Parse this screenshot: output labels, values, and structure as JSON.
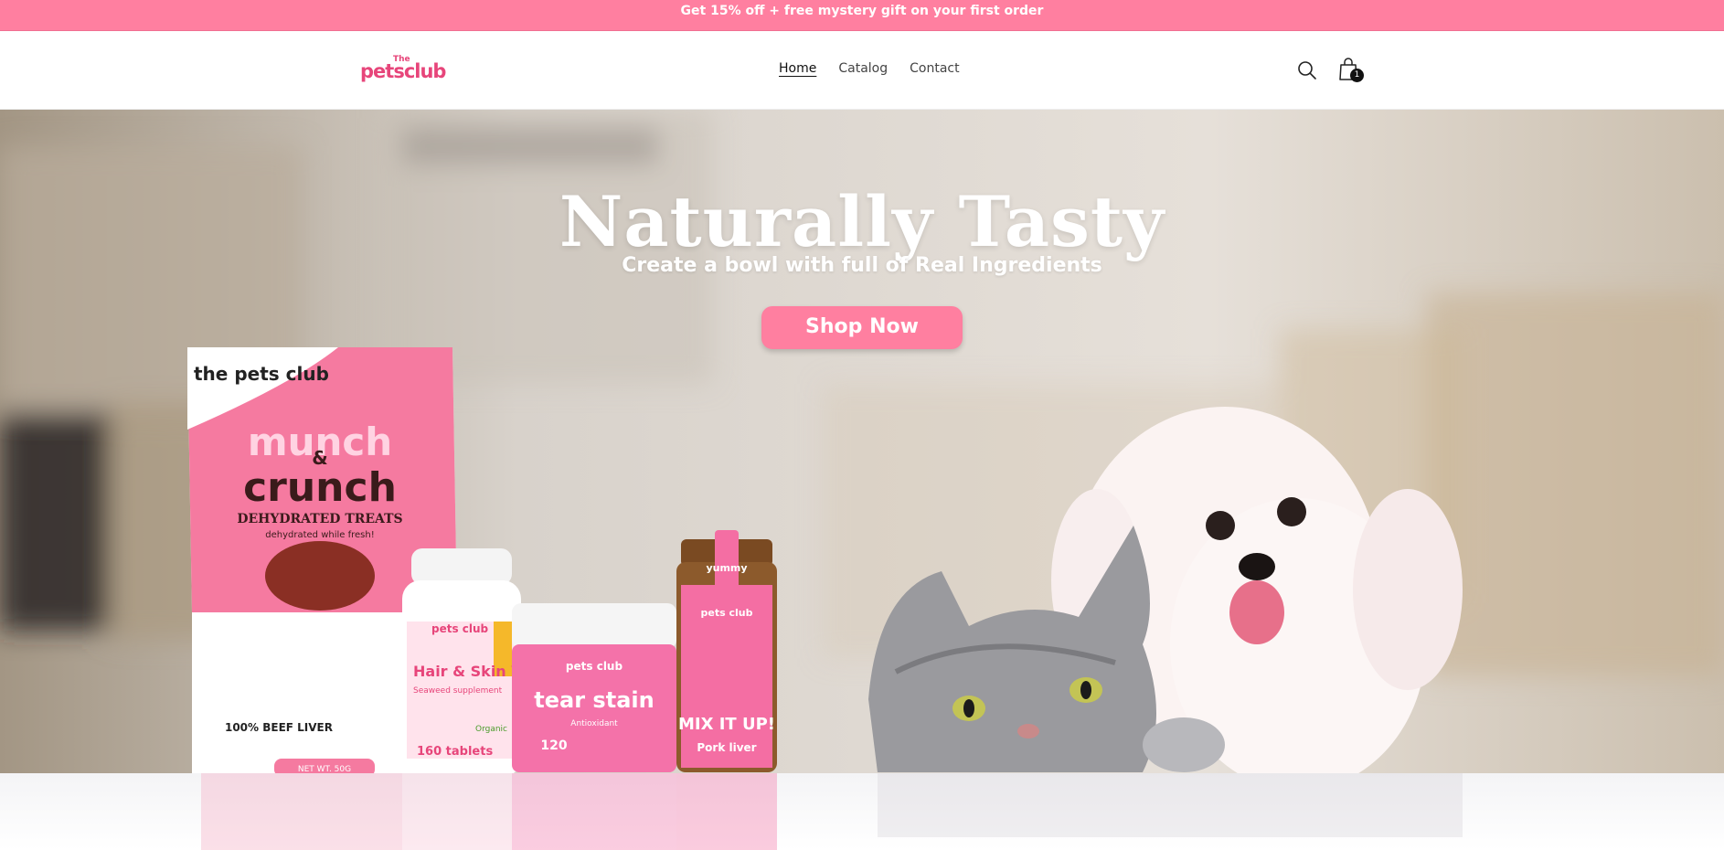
{
  "announcement": {
    "text": "Get 15% off + free mystery gift on your first order"
  },
  "header": {
    "logo_small": "The",
    "logo_name": "petsclub",
    "nav": [
      {
        "label": "Home",
        "active": true
      },
      {
        "label": "Catalog",
        "active": false
      },
      {
        "label": "Contact",
        "active": false
      }
    ],
    "icons": {
      "search": "search-icon",
      "cart": "shopping-bag-icon"
    },
    "cart_count": "1"
  },
  "hero": {
    "title": "Naturally Tasty",
    "subtitle": "Create a bowl with full of Real Ingredients",
    "cta_label": "Shop Now",
    "products": {
      "bag": {
        "brand": "the pets club",
        "name_top": "munch",
        "amp": "&",
        "name_bottom": "crunch",
        "line1": "DEHYDRATED TREATS",
        "line2": "dehydrated while fresh!",
        "flavor": "100% BEEF LIVER",
        "weight": "NET WT. 50G"
      },
      "bottle": {
        "brand": "pets club",
        "name": "Hair & Skin Vitamins",
        "sub": "Seaweed supplement",
        "count": "160 tablets",
        "badge": "Organic"
      },
      "tub": {
        "brand": "pets club",
        "name": "tear stain",
        "sub": "Antioxidant",
        "count": "120"
      },
      "jar": {
        "tag": "yummy",
        "brand": "pets club",
        "name": "MIX IT UP!",
        "flavor": "Pork liver"
      }
    }
  },
  "colors": {
    "accent": "#ff7fa0",
    "brand_text": "#e7457a",
    "white": "#ffffff"
  }
}
